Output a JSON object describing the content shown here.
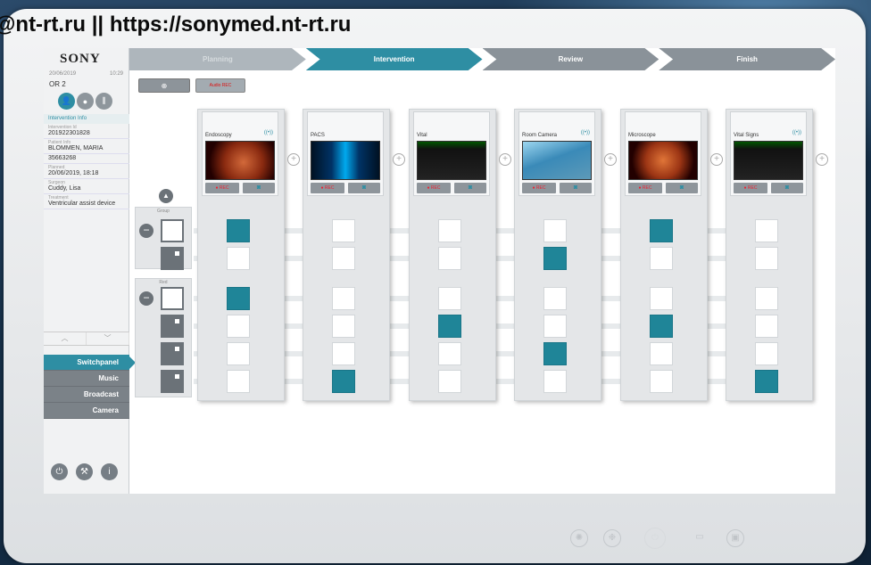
{
  "watermark": "@nt-rt.ru || https://sonymed.nt-rt.ru",
  "left": {
    "logo": "SONY",
    "date": "20/06/2019",
    "time": "10:29",
    "room": "OR 2",
    "info_header": "Intervention Info",
    "fields": [
      {
        "label": "Intervention Id",
        "value": "201922301828"
      },
      {
        "label": "Patient Info",
        "value": "BLOMMEN, MARIA"
      },
      {
        "label": "",
        "value": "35663268"
      },
      {
        "label": "Planned",
        "value": "20/06/2019, 18:18"
      },
      {
        "label": "Surgeon",
        "value": "Cuddy, Lisa"
      },
      {
        "label": "Treatment",
        "value": "Ventricular assist device"
      }
    ],
    "menu": [
      "Switchpanel",
      "Music",
      "Broadcast",
      "Camera"
    ]
  },
  "steps": [
    "Planning",
    "Intervention",
    "Review",
    "Finish"
  ],
  "toolbar": {
    "btn1": "⊕",
    "btn2": "Audio REC"
  },
  "sources": [
    {
      "name": "Endoscopy",
      "wifi": true
    },
    {
      "name": "PACS",
      "wifi": false
    },
    {
      "name": "Vital",
      "wifi": false
    },
    {
      "name": "Room Camera",
      "wifi": true
    },
    {
      "name": "Microscope",
      "wifi": false
    },
    {
      "name": "Vital Signs",
      "wifi": true
    }
  ],
  "rec_label": "● REC",
  "groups": [
    {
      "label": "Group"
    },
    {
      "label": "Red"
    }
  ],
  "matrix": [
    [
      1,
      0,
      0,
      0,
      1,
      0
    ],
    [
      0,
      0,
      0,
      1,
      0,
      0
    ],
    [
      1,
      0,
      0,
      0,
      0,
      0
    ],
    [
      0,
      0,
      1,
      0,
      1,
      0
    ],
    [
      0,
      0,
      0,
      1,
      0,
      0
    ],
    [
      0,
      1,
      0,
      0,
      0,
      1
    ]
  ],
  "colors": {
    "accent": "#2e8ea3"
  }
}
